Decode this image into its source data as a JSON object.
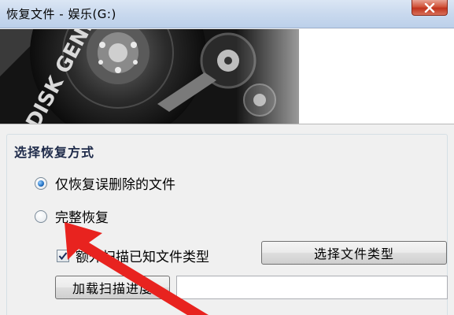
{
  "window": {
    "title": "恢复文件 - 娱乐(G:)"
  },
  "banner": {
    "brand_text": "DISK GENIUS"
  },
  "recovery_mode": {
    "group_title": "选择恢复方式",
    "options": [
      {
        "label": "仅恢复误删除的文件",
        "selected": true
      },
      {
        "label": "完整恢复",
        "selected": false
      }
    ]
  },
  "extra_scan": {
    "label": "额外扫描已知文件类型",
    "checked": true,
    "select_types_button": "选择文件类型"
  },
  "load_progress": {
    "button": "加载扫描进度",
    "path_value": ""
  },
  "annotation": {
    "arrow_color": "#e8231f"
  },
  "icons": {
    "close": "close-icon",
    "checkmark": "checkmark-icon",
    "arrow": "annotation-arrow"
  }
}
